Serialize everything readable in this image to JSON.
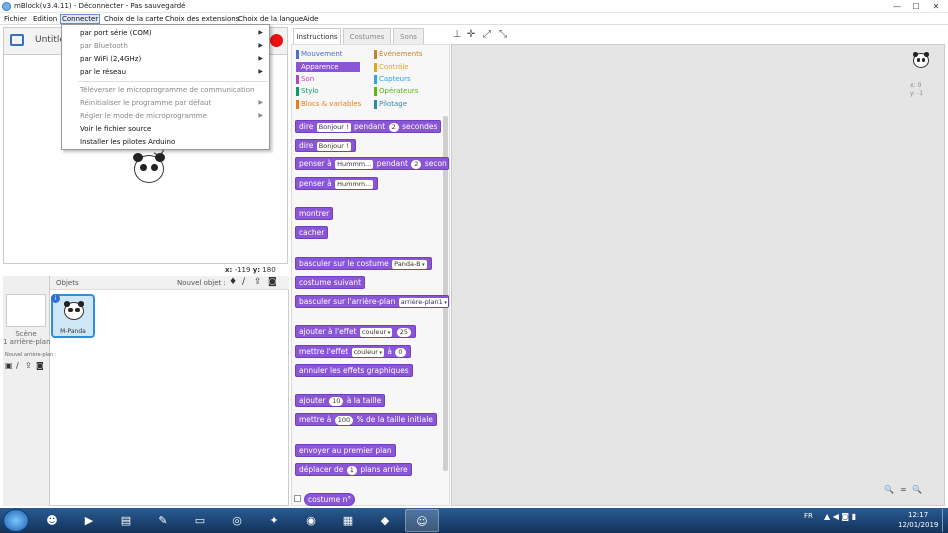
{
  "window": {
    "title": "mBlock(v3.4.11) - Déconnecter - Pas sauvegardé",
    "controls": [
      "—",
      "☐",
      "✕"
    ]
  },
  "menubar": [
    "Fichier",
    "Edition",
    "Connecter",
    "Choix de la carte",
    "Choix des extensions",
    "Choix de la langue",
    "Aide"
  ],
  "stage": {
    "title": "Untitle",
    "coords": {
      "x_label": "x:",
      "x_value": "-119",
      "y_label": "y:",
      "y_value": "180"
    }
  },
  "connect_menu": {
    "items": [
      {
        "label": "par port série (COM)",
        "disabled": false,
        "arrow": true
      },
      {
        "label": "par Bluetooth",
        "disabled": true,
        "arrow": true
      },
      {
        "label": "par WiFi (2,4GHz)",
        "disabled": false,
        "arrow": true
      },
      {
        "label": "par le réseau",
        "disabled": false,
        "arrow": true
      },
      {
        "label": "Téléverser le microprogramme de communication",
        "disabled": true,
        "arrow": false
      },
      {
        "label": "Réinitialiser le programme par défaut",
        "disabled": true,
        "arrow": true
      },
      {
        "label": "Régler le mode de microprogramme",
        "disabled": true,
        "arrow": true
      },
      {
        "label": "Voir le fichier source",
        "disabled": false,
        "arrow": false
      },
      {
        "label": "Installer les pilotes Arduino",
        "disabled": false,
        "arrow": false
      }
    ]
  },
  "sprites": {
    "header": "Objets",
    "new_object": "Nouvel objet :",
    "scene_label": "Scène",
    "scene_sub": "1 arrière-plan",
    "new_backdrop": "Nouvel arrière-plan :",
    "sprite_name": "M-Panda"
  },
  "tabs": [
    "Instructions",
    "Costumes",
    "Sons"
  ],
  "categories": [
    {
      "label": "Mouvement",
      "color": "#4a6cd4"
    },
    {
      "label": "Événements",
      "color": "#c88330"
    },
    {
      "label": "Apparence",
      "color": "#8a55d7"
    },
    {
      "label": "Contrôle",
      "color": "#e1a91a"
    },
    {
      "label": "Son",
      "color": "#bb42c3"
    },
    {
      "label": "Capteurs",
      "color": "#2ca5e2"
    },
    {
      "label": "Stylo",
      "color": "#0e9a6c"
    },
    {
      "label": "Opérateurs",
      "color": "#5cb712"
    },
    {
      "label": "Blocs & variables",
      "color": "#ee7d16"
    },
    {
      "label": "Pilotage",
      "color": "#2e8ba8"
    }
  ],
  "blocks": {
    "b1": {
      "a": "dire",
      "s1": "Bonjour !",
      "b": "pendant",
      "s2": "2",
      "c": "secondes"
    },
    "b2": {
      "a": "dire",
      "s1": "Bonjour !"
    },
    "b3": {
      "a": "penser à",
      "s1": "Hummm...",
      "b": "pendant",
      "s2": "2",
      "c": "secon"
    },
    "b4": {
      "a": "penser à",
      "s1": "Hummm..."
    },
    "b5": {
      "a": "montrer"
    },
    "b6": {
      "a": "cacher"
    },
    "b7": {
      "a": "basculer sur le costume",
      "s1": "Panda-B"
    },
    "b8": {
      "a": "costume suivant"
    },
    "b9": {
      "a": "basculer sur l'arrière-plan",
      "s1": "arrière-plan1"
    },
    "b10": {
      "a": "ajouter à l'effet",
      "s1": "couleur",
      "s2": "25"
    },
    "b11": {
      "a": "mettre l'effet",
      "s1": "couleur",
      "b": "à",
      "s2": "0"
    },
    "b12": {
      "a": "annuler les effets graphiques"
    },
    "b13": {
      "a": "ajouter",
      "s1": "10",
      "b": "à la taille"
    },
    "b14": {
      "a": "mettre à",
      "s1": "100",
      "b": "% de la taille initiale"
    },
    "b15": {
      "a": "envoyer au premier plan"
    },
    "b16": {
      "a": "déplacer de",
      "s1": "1",
      "b": "plans arrière"
    },
    "b17": {
      "a": "costume n°"
    }
  },
  "script_area": {
    "sprite_x": "x: 0",
    "sprite_y": "y: -1",
    "zoom_labels": [
      "🔍",
      "=",
      "🔍"
    ]
  },
  "taskbar": {
    "lang": "FR",
    "time": "12:17",
    "date": "12/01/2019"
  }
}
